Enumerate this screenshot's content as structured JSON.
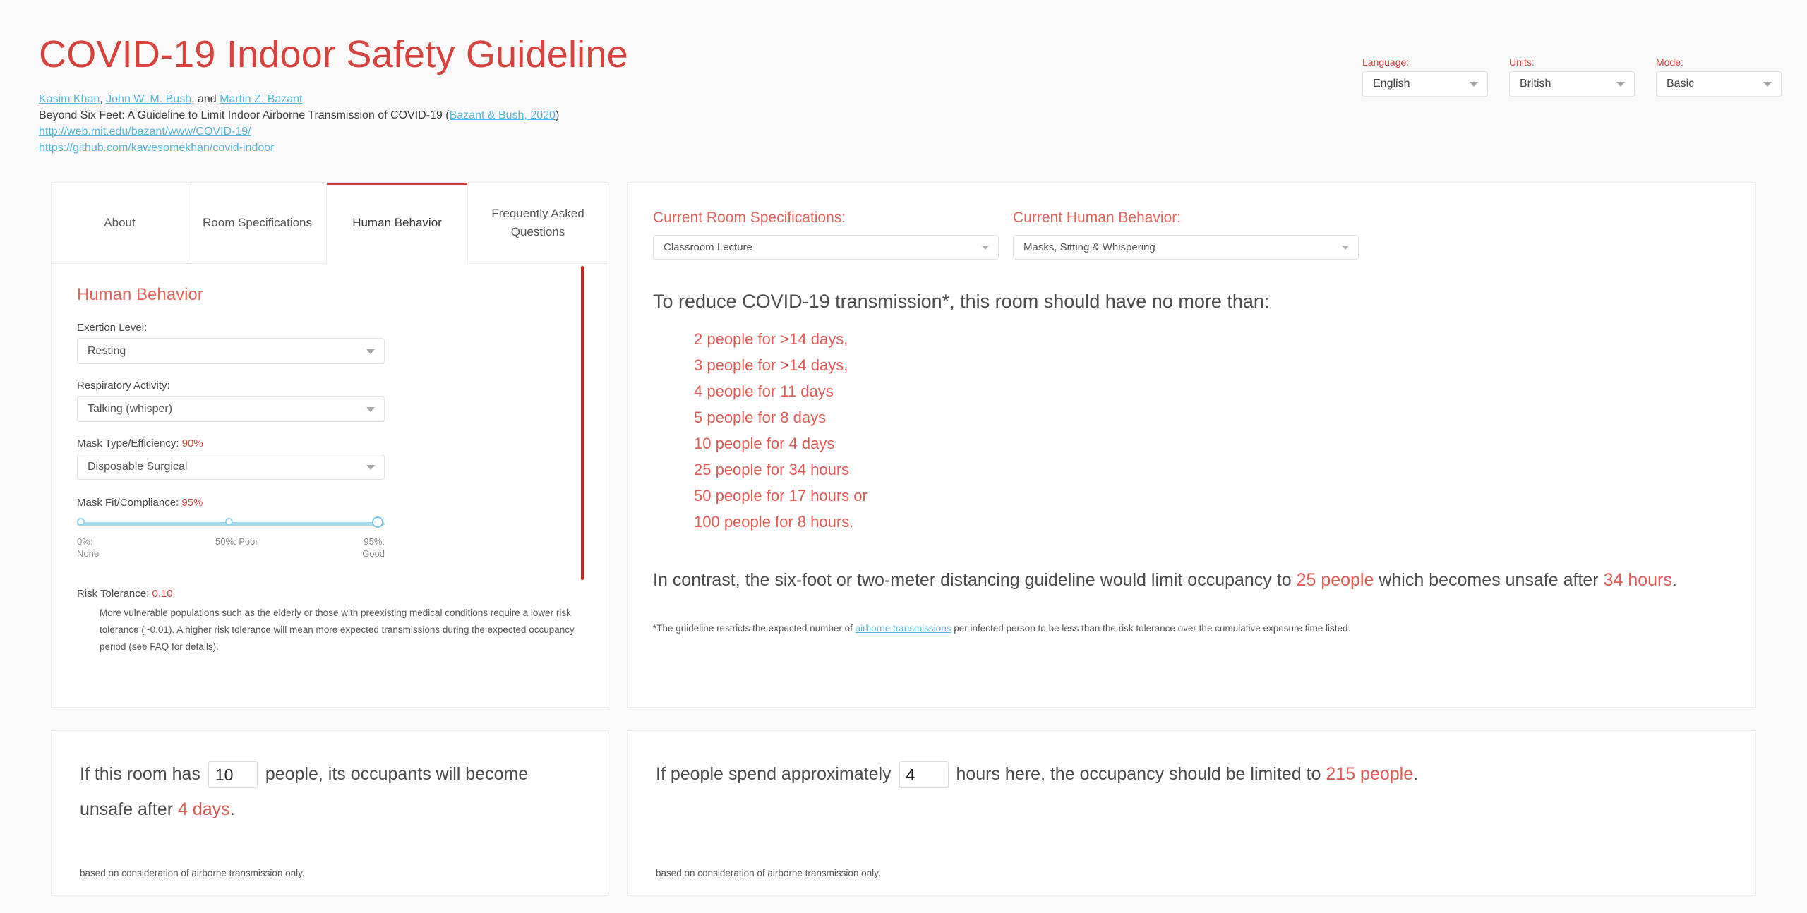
{
  "header": {
    "title": "COVID-19 Indoor Safety Guideline",
    "authors": [
      {
        "text": "Kasim Khan",
        "link": true
      },
      {
        "text": ", ",
        "link": false
      },
      {
        "text": "John W. M. Bush",
        "link": true
      },
      {
        "text": ", and ",
        "link": false
      },
      {
        "text": "Martin Z. Bazant",
        "link": true
      }
    ],
    "paper_prefix": "Beyond Six Feet: A Guideline to Limit Indoor Airborne Transmission of COVID-19 (",
    "paper_citation": "Bazant & Bush, 2020",
    "paper_suffix": ")",
    "url_mit": "http://web.mit.edu/bazant/www/COVID-19/",
    "url_github": "https://github.com/kawesomekhan/covid-indoor"
  },
  "top_selects": [
    {
      "label": "Language:",
      "value": "English",
      "name": "language"
    },
    {
      "label": "Units:",
      "value": "British",
      "name": "units"
    },
    {
      "label": "Mode:",
      "value": "Basic",
      "name": "mode"
    }
  ],
  "tabs": [
    {
      "label": "About",
      "active": false
    },
    {
      "label": "Room Specifications",
      "active": false
    },
    {
      "label": "Human Behavior",
      "active": true
    },
    {
      "label": "Frequently Asked Questions",
      "active": false
    }
  ],
  "left_panel": {
    "section_title": "Human Behavior",
    "exertion": {
      "label": "Exertion Level:",
      "value": "Resting"
    },
    "respiratory": {
      "label": "Respiratory Activity:",
      "value": "Talking (whisper)"
    },
    "mask_type": {
      "label_prefix": "Mask Type/Efficiency: ",
      "label_value": "90%",
      "value": "Disposable Surgical"
    },
    "mask_fit": {
      "label_prefix": "Mask Fit/Compliance: ",
      "label_value": "95%",
      "marks": [
        {
          "top": "0%:",
          "bottom": "None"
        },
        {
          "top": "50%: Poor",
          "bottom": ""
        },
        {
          "top": "95%:",
          "bottom": "Good"
        }
      ]
    },
    "risk": {
      "label_prefix": "Risk Tolerance: ",
      "label_value": "0.10",
      "description": "More vulnerable populations such as the elderly or those with preexisting medical conditions require a lower risk tolerance (~0.01). A higher risk tolerance will mean more expected transmissions during the expected occupancy period (see FAQ for details)."
    }
  },
  "right_panel": {
    "room_spec": {
      "label": "Current Room Specifications:",
      "value": "Classroom Lecture"
    },
    "human_behavior": {
      "label": "Current Human Behavior:",
      "value": "Masks, Sitting & Whispering"
    },
    "lead": "To reduce COVID-19 transmission*, this room should have no more than:",
    "occupancy_list": [
      "2 people for >14 days,",
      "3 people for >14 days,",
      "4 people for 11 days",
      "5 people for 8 days",
      "10 people for 4 days",
      "25 people for 34 hours",
      "50 people for 17 hours or",
      "100 people for 8 hours."
    ],
    "contrast": {
      "part1": "In contrast, the six-foot or two-meter distancing guideline would limit occupancy to ",
      "people": "25 people",
      "part2": " which becomes unsafe after ",
      "duration": "34 hours",
      "part3": "."
    },
    "footnote": {
      "part1": "*The guideline restricts the expected number of ",
      "link": "airborne transmissions",
      "part2": " per infected person to be less than the risk tolerance over the cumulative exposure time listed."
    }
  },
  "bottom_left": {
    "part1": "If this room has",
    "input_value": "10",
    "part2": "people, its occupants will become unsafe after",
    "result": "4 days",
    "part3": ".",
    "footnote": "based on consideration of airborne transmission only."
  },
  "bottom_right": {
    "part1": "If people spend approximately",
    "input_value": "4",
    "part2": "hours here, the occupancy should be limited to",
    "result": "215 people",
    "part3": ".",
    "footnote": "based on consideration of airborne transmission only."
  },
  "colors": {
    "accent_red": "#d6423c",
    "soft_red": "#e05a53",
    "link_blue": "#5bb7d6",
    "slider_blue": "#a5dbef",
    "page_bg": "#f9f9f9"
  }
}
